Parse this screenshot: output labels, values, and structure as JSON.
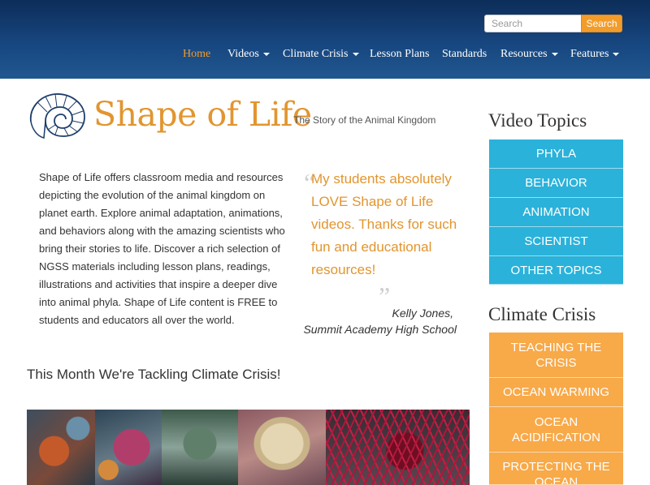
{
  "search": {
    "placeholder": "Search",
    "button_label": "Search"
  },
  "nav": {
    "items": [
      {
        "label": "Home",
        "active": true,
        "dropdown": false
      },
      {
        "label": "Videos",
        "dropdown": true
      },
      {
        "label": "Climate Crisis",
        "dropdown": true
      },
      {
        "label": "Lesson Plans",
        "dropdown": false
      },
      {
        "label": "Standards",
        "dropdown": false
      },
      {
        "label": "Resources",
        "dropdown": true
      },
      {
        "label": "Features",
        "dropdown": true
      }
    ]
  },
  "logo": {
    "title": "Shape of Life",
    "tagline": "The Story of the Animal Kingdom",
    "icon": "nautilus-shell-icon"
  },
  "intro": {
    "text": "Shape of Life offers classroom media and resources depicting the evolution of the animal kingdom on planet earth. Explore animal adaptation, animations, and behaviors along with the amazing scientists who bring their stories to life. Discover a rich selection of NGSS materials including lesson plans, readings, illustrations and activities that inspire a deeper dive into animal phyla. Shape of Life content is FREE to students and educators all over the world."
  },
  "quote": {
    "open_mark": "“",
    "close_mark": "”",
    "text": "My students absolutely LOVE Shape of Life videos. Thanks for such fun and educational resources!",
    "author": "Kelly Jones,",
    "school": "Summit Academy High School"
  },
  "month": {
    "heading": "This Month We're Tackling Climate Crisis!"
  },
  "sidebar": {
    "video_topics": {
      "heading": "Video Topics",
      "items": [
        "PHYLA",
        "BEHAVIOR",
        "ANIMATION",
        "SCIENTIST",
        "OTHER TOPICS"
      ]
    },
    "climate_crisis": {
      "heading": "Climate Crisis",
      "items": [
        "TEACHING THE CRISIS",
        "OCEAN WARMING",
        "OCEAN ACIDIFICATION",
        "PROTECTING THE OCEAN"
      ]
    }
  },
  "colors": {
    "header_blue": "#17467f",
    "accent_orange": "#f39c2a",
    "topic_blue": "#2ab2da",
    "climate_orange": "#f8a948"
  }
}
